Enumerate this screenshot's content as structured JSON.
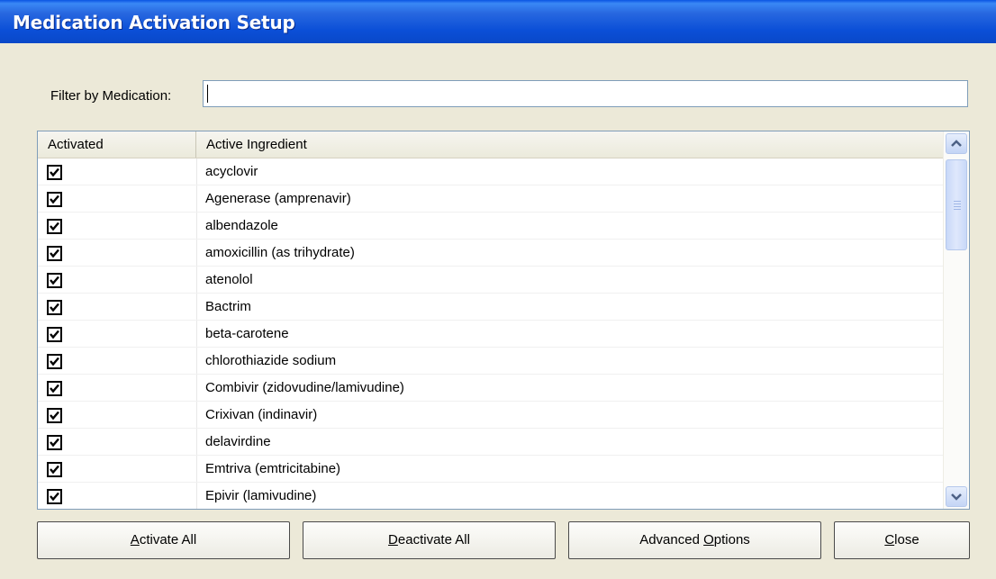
{
  "window": {
    "title": "Medication Activation Setup"
  },
  "filter": {
    "label": "Filter by Medication:",
    "value": ""
  },
  "grid": {
    "columns": [
      "Activated",
      "Active Ingredient"
    ],
    "rows": [
      {
        "activated": true,
        "ingredient": "acyclovir"
      },
      {
        "activated": true,
        "ingredient": "Agenerase (amprenavir)"
      },
      {
        "activated": true,
        "ingredient": "albendazole"
      },
      {
        "activated": true,
        "ingredient": "amoxicillin (as trihydrate)"
      },
      {
        "activated": true,
        "ingredient": "atenolol"
      },
      {
        "activated": true,
        "ingredient": "Bactrim"
      },
      {
        "activated": true,
        "ingredient": "beta-carotene"
      },
      {
        "activated": true,
        "ingredient": "chlorothiazide sodium"
      },
      {
        "activated": true,
        "ingredient": "Combivir (zidovudine/lamivudine)"
      },
      {
        "activated": true,
        "ingredient": "Crixivan (indinavir)"
      },
      {
        "activated": true,
        "ingredient": "delavirdine"
      },
      {
        "activated": true,
        "ingredient": "Emtriva (emtricitabine)"
      },
      {
        "activated": true,
        "ingredient": "Epivir (lamivudine)"
      }
    ]
  },
  "buttons": {
    "activate_all": {
      "mnemonic": "A",
      "rest": "ctivate All"
    },
    "deactivate_all": {
      "mnemonic": "D",
      "rest": "eactivate All"
    },
    "advanced_options": {
      "before": "Advanced ",
      "mnemonic": "O",
      "rest": "ptions"
    },
    "close": {
      "mnemonic": "C",
      "rest": "lose"
    }
  },
  "icons": {
    "scroll_up": "chevron-up-icon",
    "scroll_down": "chevron-down-icon",
    "check": "checkmark-icon"
  },
  "colors": {
    "titlebar": "#0a54e3",
    "window_bg": "#ece9d8",
    "border": "#7f9db9"
  }
}
